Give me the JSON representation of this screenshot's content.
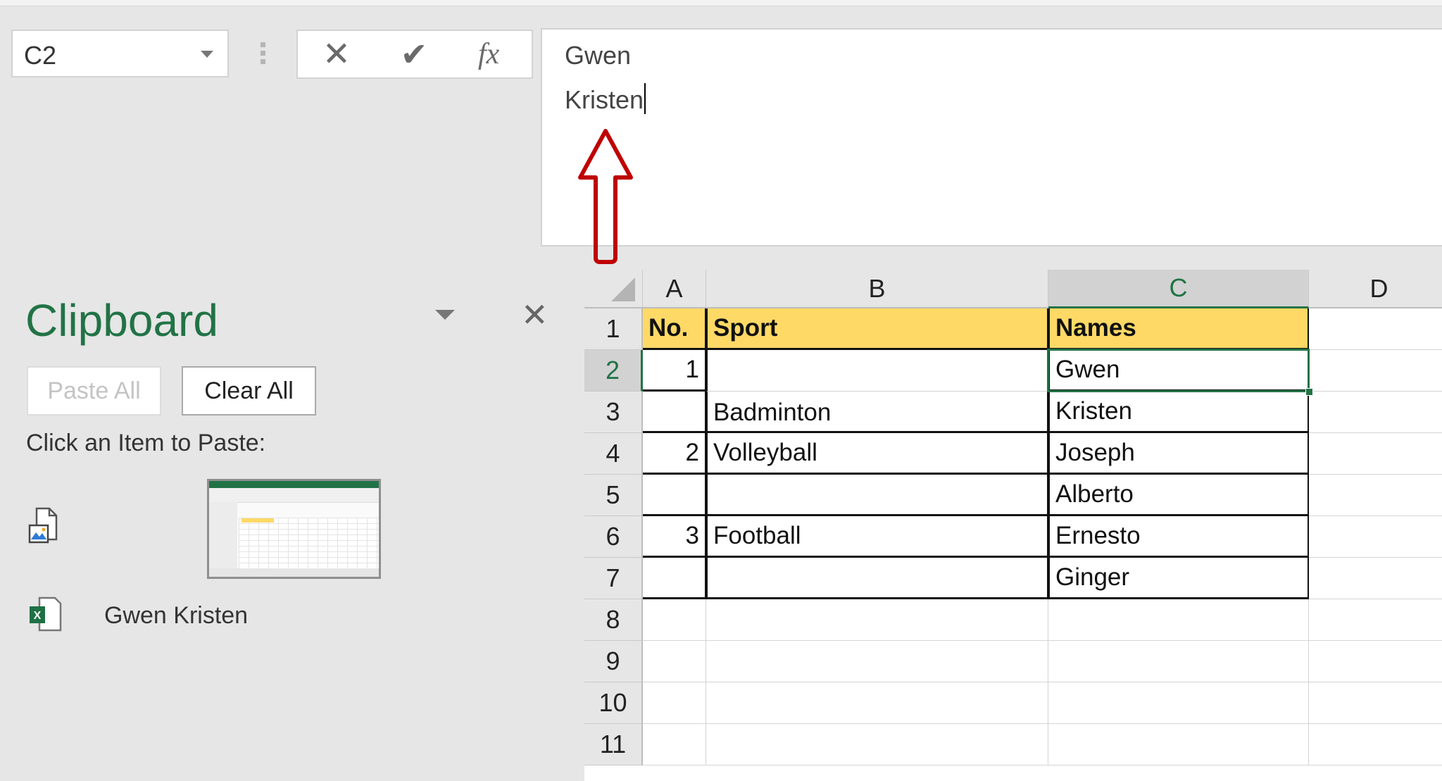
{
  "formula_bar": {
    "name_box": "C2",
    "cancel_icon": "close-icon",
    "enter_icon": "check-icon",
    "function_icon": "fx-icon",
    "fx_label": "fx",
    "cancel_glyph": "✕",
    "enter_glyph": "✔",
    "content_lines": [
      "Gwen",
      "Kristen"
    ]
  },
  "annotation": {
    "type": "arrow-up",
    "color": "#c00000"
  },
  "clipboard_pane": {
    "title": "Clipboard",
    "paste_all_label": "Paste All",
    "clear_all_label": "Clear All",
    "hint": "Click an Item to Paste:",
    "close_glyph": "✕",
    "items": [
      {
        "type": "image",
        "icon": "picture-file-icon",
        "label": ""
      },
      {
        "type": "excel",
        "icon": "excel-file-icon",
        "label": "Gwen Kristen"
      }
    ]
  },
  "sheet": {
    "active_cell": "C2",
    "columns": [
      "A",
      "B",
      "C",
      "D"
    ],
    "rows": [
      "1",
      "2",
      "3",
      "4",
      "5",
      "6",
      "7",
      "8",
      "9",
      "10",
      "11"
    ],
    "header_row": {
      "A": "No.",
      "B": "Sport",
      "C": "Names"
    },
    "cells": {
      "A2": "1",
      "C2": "Gwen",
      "B3": "Badminton",
      "C3": "Kristen",
      "A4": "2",
      "B4": "Volleyball",
      "C4": "Joseph",
      "C5": "Alberto",
      "A6": "3",
      "B6": "Football",
      "C6": "Ernesto",
      "C7": "Ginger"
    },
    "colors": {
      "header_fill": "#ffd966",
      "selection": "#217346"
    }
  }
}
